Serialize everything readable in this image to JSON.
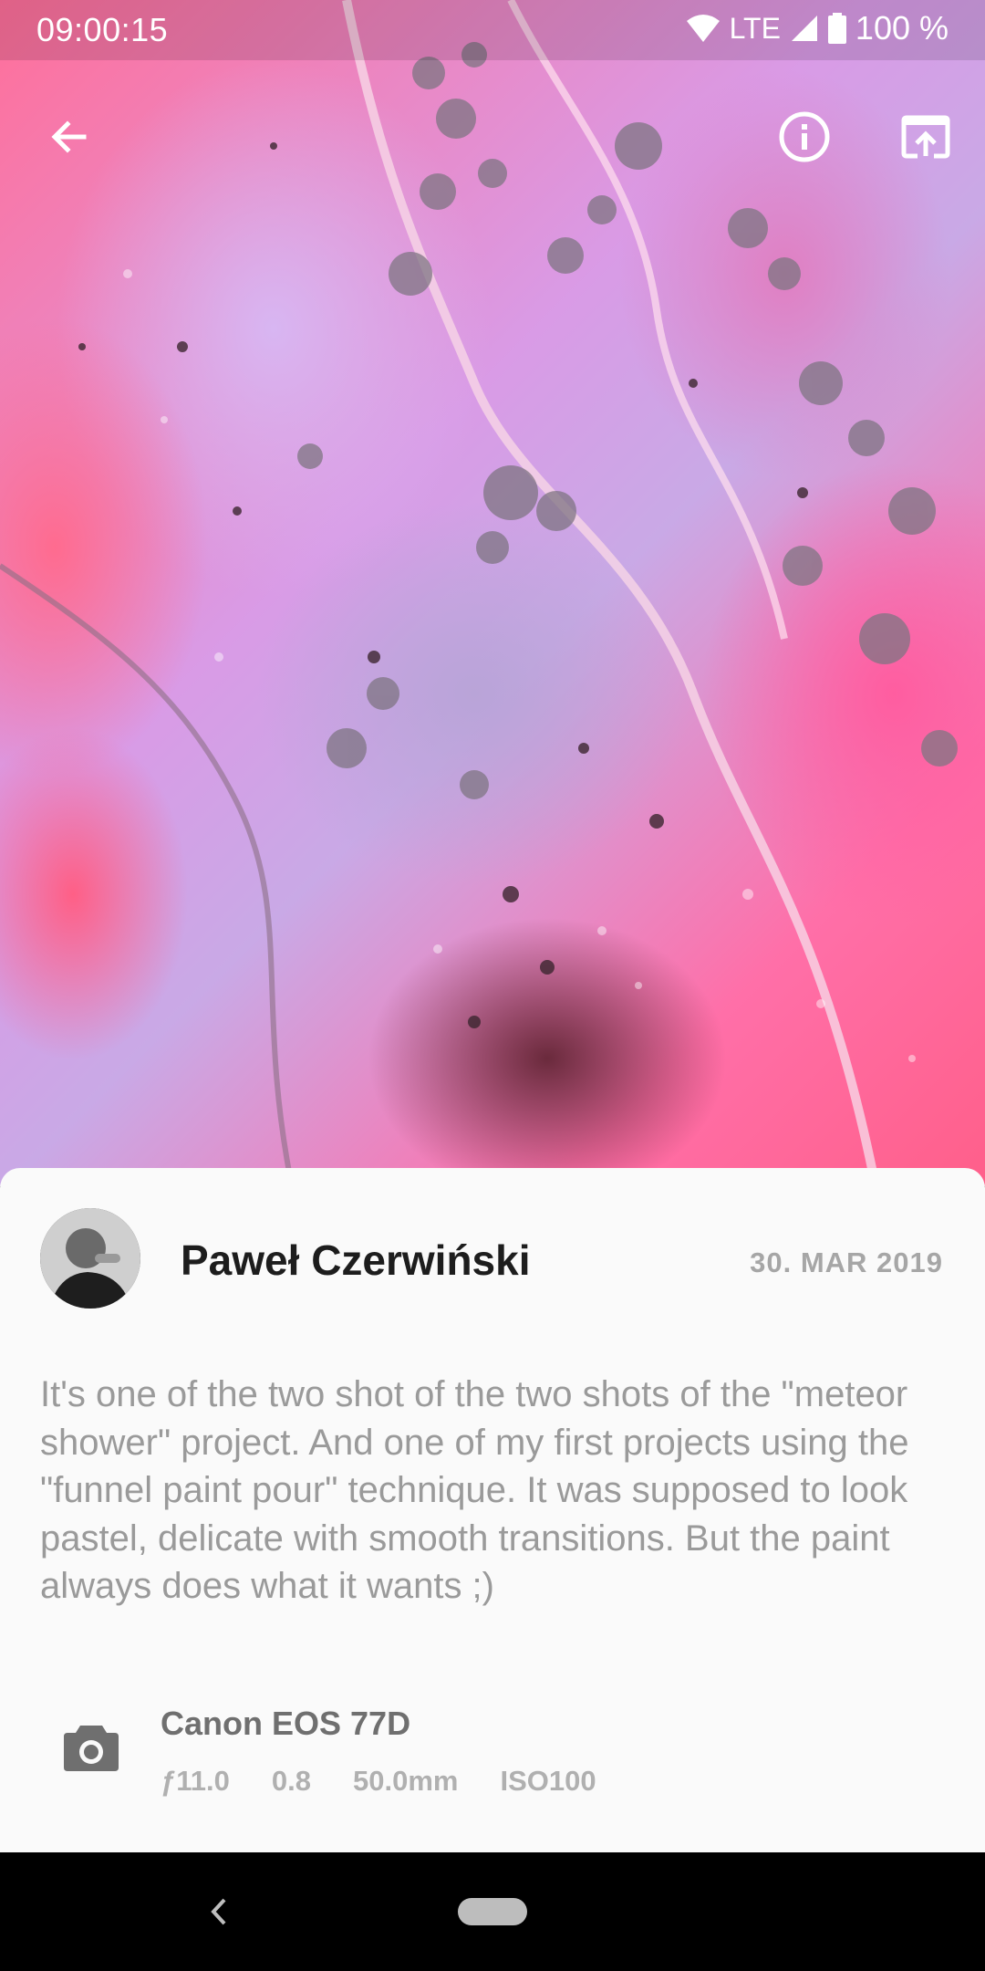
{
  "status_bar": {
    "time": "09:00:15",
    "network": "LTE",
    "battery": "100 %"
  },
  "toolbar": {
    "back_icon": "arrow-left-icon",
    "info_icon": "info-icon",
    "open_icon": "open-in-browser-icon"
  },
  "photo": {
    "description_visual": "abstract pink and lavender paint pour with cells"
  },
  "author": {
    "name": "Paweł Czerwiński",
    "date": "30. MAR 2019"
  },
  "description": "It's one of the two shot of the two shots of the \"meteor shower\" project. And one of my first projects using the \"funnel paint pour\" technique. It was supposed to look pastel, delicate with smooth transitions. But the paint always does what it wants ;)",
  "exif": {
    "camera": "Canon EOS 77D",
    "aperture": "ƒ11.0",
    "exposure": "0.8",
    "focal_length": "50.0mm",
    "iso": "ISO100"
  },
  "colors": {
    "sheet_bg": "#fafafa",
    "author_text": "#1d1d1d",
    "secondary_text": "#9a9a9a"
  }
}
